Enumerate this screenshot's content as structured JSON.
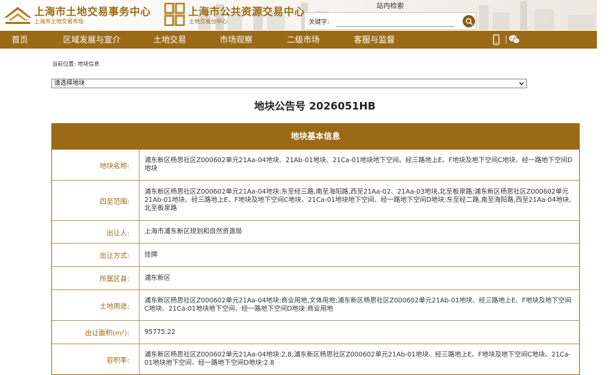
{
  "header": {
    "logo1_title": "上海市土地交易事务中心",
    "logo1_sub": "上海市土地交易市场",
    "logo2_title": "上海市公共资源交易中心",
    "logo2_sub": "土地交易分中心",
    "search_title": "站内检索",
    "search_label": "关键字:",
    "search_value": ""
  },
  "nav": {
    "items": [
      "首页",
      "区域发展与宣介",
      "土地交易",
      "市场观察",
      "二级市场",
      "客服与监督"
    ]
  },
  "breadcrumb": "当前位置: 地块信息",
  "select": {
    "selected": "请选择地块"
  },
  "notice_title": "地块公告号 2026051HB",
  "info": {
    "header": "地块基本信息",
    "rows": [
      {
        "label": "地块名称:",
        "value": "浦东新区杨思社区Z000602单元21Aa-04地块、21Ab-01地块、21Ca-01地块地下空间、经三路地上E、F地块及地下空间C地块、经一路地下空间D地块"
      },
      {
        "label": "四至范围:",
        "value": "浦东新区杨思社区Z000602单元21Aa-04地块:东至经三路,南至海阳路,西至21Aa-02、21Aa-03地块,北至板泉路;浦东新区杨思社区Z000602单元21Ab-01地块、经三路地上E、F地块及地下空间C地块、21Ca-01地块地下空间、经一路地下空间D地块:东至经二路,南至海阳路,西至21Aa-04地块,北至板泉路"
      },
      {
        "label": "出让人:",
        "value": "上海市浦东新区规划和自然资源局"
      },
      {
        "label": "出让方式:",
        "value": "挂牌"
      },
      {
        "label": "所属区县:",
        "value": "浦东新区"
      },
      {
        "label": "土地用途:",
        "value": "浦东新区杨思社区Z000602单元21Aa-04地块:商业用地,文体用地;浦东新区杨思社区Z000602单元21Ab-01地块、经三路地上E、F地块及地下空间C地块、21Ca-01地块地下空间、经一路地下空间D地块:商业用地"
      },
      {
        "label": "出让面积(m²):",
        "value": "95775.22"
      },
      {
        "label": "容积率:",
        "value": "浦东新区杨思社区Z000602单元21Aa-04地块:2.8;浦东新区杨思社区Z000602单元21Ab-01地块、经三路地上E、F地块及地下空间C地块、21Ca-01地块地下空间、经一路地下空间D地块:2.8"
      }
    ]
  },
  "colors": {
    "brand": "#9a6a16",
    "border": "#b9995e",
    "label": "#9a6a16"
  }
}
